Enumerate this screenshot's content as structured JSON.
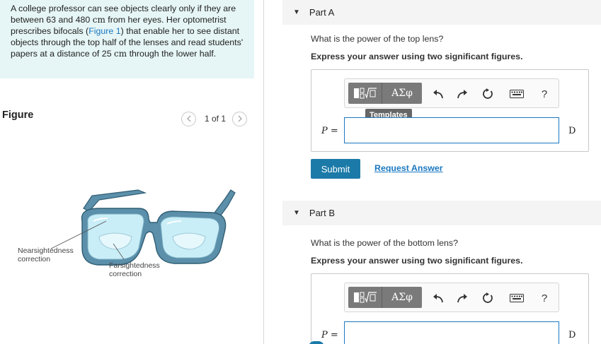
{
  "problem": {
    "text_1": "A college professor can see objects clearly only if they are between 63 and 480 ",
    "unit_1": "cm",
    "text_2": " from her eyes. Her optometrist prescribes bifocals (",
    "figure_link": "Figure 1",
    "text_3": ") that enable her to see distant objects through the top half of the lenses and read students' papers at a distance of 25 ",
    "unit_2": "cm",
    "text_4": " through the lower half."
  },
  "figure": {
    "title": "Figure",
    "pager_text": "1 of 1",
    "prev_icon": "chevron-left-icon",
    "next_icon": "chevron-right-icon",
    "label_nearsighted": "Nearsightedness correction",
    "label_farsighted": "Farsightedness correction",
    "frame_color": "#5b8faa",
    "lens_color": "#c9eef7"
  },
  "part_a": {
    "title": "Part A",
    "question": "What is the power of the top lens?",
    "instruction": "Express your answer using two significant figures.",
    "toolbar": {
      "greek_label": "ΑΣφ",
      "templates_tooltip": "Templates",
      "help_label": "?"
    },
    "variable": "P",
    "equals": " =",
    "input_value": "",
    "unit": "D",
    "submit_label": "Submit",
    "request_answer_label": "Request Answer"
  },
  "part_b": {
    "title": "Part B",
    "question": "What is the power of the bottom lens?",
    "instruction": "Express your answer using two significant figures.",
    "toolbar": {
      "greek_label": "ΑΣφ",
      "help_label": "?"
    },
    "variable": "P",
    "equals": " =",
    "input_value": "",
    "unit": "D"
  },
  "colors": {
    "accent": "#1a78c2",
    "submit_bg": "#1b7aa8",
    "problem_bg": "#e6f5f5"
  }
}
